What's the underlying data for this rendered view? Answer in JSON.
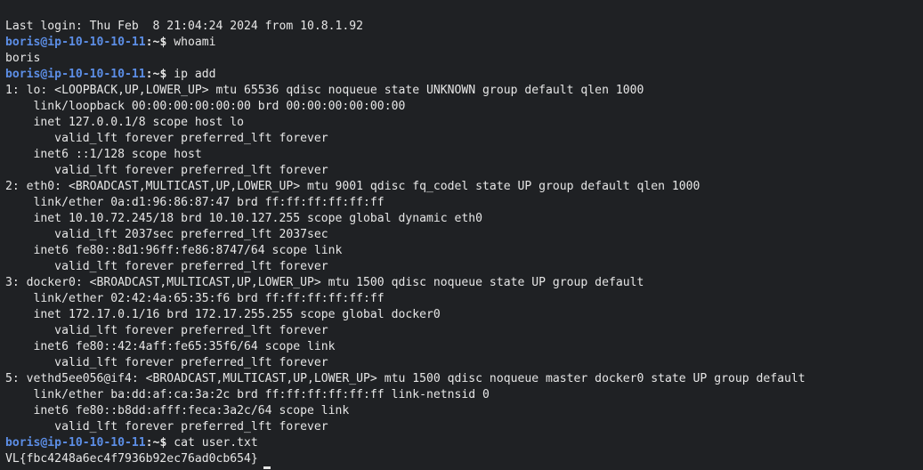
{
  "terminal": {
    "prompt": {
      "user_host": "boris@ip-10-10-10-11",
      "sep": ":~$"
    },
    "lines": [
      {
        "kind": "out",
        "text": "Last login: Thu Feb  8 21:04:24 2024 from 10.8.1.92"
      },
      {
        "kind": "cmd",
        "text": " whoami"
      },
      {
        "kind": "out",
        "text": "boris"
      },
      {
        "kind": "cmd",
        "text": " ip add"
      },
      {
        "kind": "out",
        "text": "1: lo: <LOOPBACK,UP,LOWER_UP> mtu 65536 qdisc noqueue state UNKNOWN group default qlen 1000"
      },
      {
        "kind": "out",
        "text": "    link/loopback 00:00:00:00:00:00 brd 00:00:00:00:00:00"
      },
      {
        "kind": "out",
        "text": "    inet 127.0.0.1/8 scope host lo"
      },
      {
        "kind": "out",
        "text": "       valid_lft forever preferred_lft forever"
      },
      {
        "kind": "out",
        "text": "    inet6 ::1/128 scope host"
      },
      {
        "kind": "out",
        "text": "       valid_lft forever preferred_lft forever"
      },
      {
        "kind": "out",
        "text": "2: eth0: <BROADCAST,MULTICAST,UP,LOWER_UP> mtu 9001 qdisc fq_codel state UP group default qlen 1000"
      },
      {
        "kind": "out",
        "text": "    link/ether 0a:d1:96:86:87:47 brd ff:ff:ff:ff:ff:ff"
      },
      {
        "kind": "out",
        "text": "    inet 10.10.72.245/18 brd 10.10.127.255 scope global dynamic eth0"
      },
      {
        "kind": "out",
        "text": "       valid_lft 2037sec preferred_lft 2037sec"
      },
      {
        "kind": "out",
        "text": "    inet6 fe80::8d1:96ff:fe86:8747/64 scope link"
      },
      {
        "kind": "out",
        "text": "       valid_lft forever preferred_lft forever"
      },
      {
        "kind": "out",
        "text": "3: docker0: <BROADCAST,MULTICAST,UP,LOWER_UP> mtu 1500 qdisc noqueue state UP group default"
      },
      {
        "kind": "out",
        "text": "    link/ether 02:42:4a:65:35:f6 brd ff:ff:ff:ff:ff:ff"
      },
      {
        "kind": "out",
        "text": "    inet 172.17.0.1/16 brd 172.17.255.255 scope global docker0"
      },
      {
        "kind": "out",
        "text": "       valid_lft forever preferred_lft forever"
      },
      {
        "kind": "out",
        "text": "    inet6 fe80::42:4aff:fe65:35f6/64 scope link"
      },
      {
        "kind": "out",
        "text": "       valid_lft forever preferred_lft forever"
      },
      {
        "kind": "out",
        "text": "5: vethd5ee056@if4: <BROADCAST,MULTICAST,UP,LOWER_UP> mtu 1500 qdisc noqueue master docker0 state UP group default"
      },
      {
        "kind": "out",
        "text": "    link/ether ba:dd:af:ca:3a:2c brd ff:ff:ff:ff:ff:ff link-netnsid 0"
      },
      {
        "kind": "out",
        "text": "    inet6 fe80::b8dd:afff:feca:3a2c/64 scope link"
      },
      {
        "kind": "out",
        "text": "       valid_lft forever preferred_lft forever"
      },
      {
        "kind": "cmd",
        "text": " cat user.txt"
      },
      {
        "kind": "out",
        "text": "VL{fbc4248a6ec4f7936b92ec76ad0cb654}",
        "cursor": true
      }
    ],
    "colors": {
      "background": "#1f2124",
      "foreground": "#e6e6e6",
      "prompt": "#5c8ee6"
    }
  }
}
